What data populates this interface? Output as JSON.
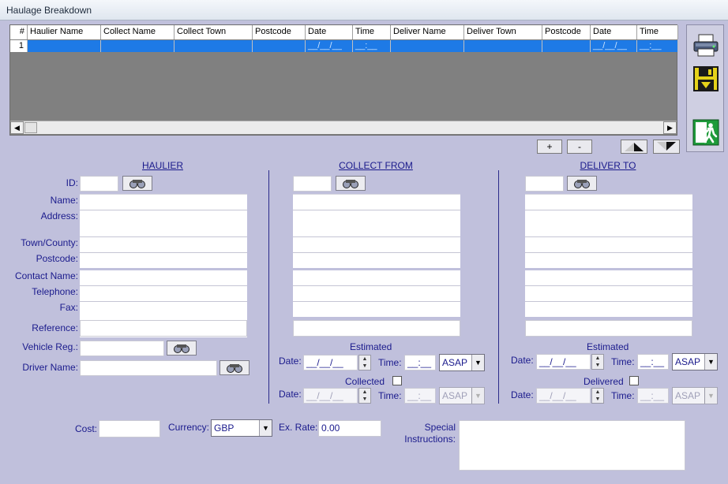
{
  "window": {
    "title": "Haulage Breakdown"
  },
  "grid": {
    "columns": [
      "#",
      "Haulier Name",
      "Collect Name",
      "Collect Town",
      "Postcode",
      "Date",
      "Time",
      "Deliver Name",
      "Deliver Town",
      "Postcode",
      "Date",
      "Time"
    ],
    "row": [
      "1",
      "",
      "",
      "",
      "",
      "__/__/__",
      "__:__",
      "",
      "",
      "",
      "__/__/__",
      "__:__"
    ]
  },
  "grid_buttons": {
    "add": "+",
    "remove": "-"
  },
  "sections": {
    "haulier": "HAULIER",
    "collect": "COLLECT FROM",
    "deliver": "DELIVER TO"
  },
  "labels": {
    "id": "ID:",
    "name": "Name:",
    "address": "Address:",
    "town": "Town/County:",
    "postcode": "Postcode:",
    "contact": "Contact Name:",
    "telephone": "Telephone:",
    "fax": "Fax:",
    "reference": "Reference:",
    "vehicle": "Vehicle Reg.:",
    "driver": "Driver Name:",
    "estimated": "Estimated",
    "collected": "Collected",
    "delivered": "Delivered",
    "date": "Date:",
    "time": "Time:",
    "cost": "Cost:",
    "currency": "Currency:",
    "exrate": "Ex. Rate:",
    "special": "Special\nInstructions:"
  },
  "values": {
    "date_mask": "__/__/__",
    "time_mask": "__:__",
    "asap": "ASAP",
    "currency": "GBP",
    "exrate": "0.00"
  },
  "icons": {
    "printer": "printer-icon",
    "save": "save-disk-icon",
    "exit": "exit-door-icon",
    "find": "binoculars-icon",
    "prev": "previous-record-icon",
    "next": "next-record-icon"
  }
}
